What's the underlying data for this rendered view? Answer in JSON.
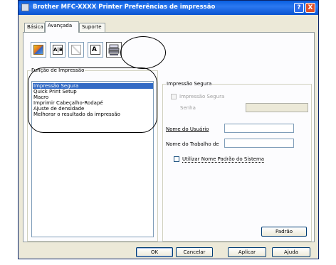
{
  "window": {
    "title": "Brother MFC-XXXX Printer Preferências de impressão"
  },
  "titlebar": {
    "help_symbol": "?",
    "close_symbol": "X"
  },
  "tabs": [
    {
      "label": "Básica",
      "active": false
    },
    {
      "label": "Avançada",
      "active": true
    },
    {
      "label": "Suporte",
      "active": false
    }
  ],
  "toolbar_icons": [
    {
      "name": "color-quality-icon"
    },
    {
      "name": "scaling-icon",
      "glyph": "A|B"
    },
    {
      "name": "watermark-icon"
    },
    {
      "name": "page-setup-icon",
      "glyph": "A"
    },
    {
      "name": "device-options-icon"
    }
  ],
  "function_group": {
    "title": "Função de Impressão",
    "items": [
      {
        "label": "Impressão Segura",
        "selected": true
      },
      {
        "label": "Quick Print Setup",
        "selected": false
      },
      {
        "label": "Macro",
        "selected": false
      },
      {
        "label": "Imprimir Cabeçalho-Rodapé",
        "selected": false
      },
      {
        "label": "Ajuste de densidade",
        "selected": false
      },
      {
        "label": "Melhorar o resultado da impressão",
        "selected": false
      }
    ]
  },
  "secure_group": {
    "title": "Impressão Segura",
    "secure_checkbox_label": "Impressão Segura",
    "password_label": "Senha",
    "username_label": "Nome do Usuário",
    "username_value": "",
    "jobname_label": "Nome do Trabalho de",
    "jobname_value": "",
    "default_name_label": "Utilizar Nome Padrão do Sistema"
  },
  "buttons": {
    "default": "Padrão",
    "ok": "OK",
    "cancel": "Cancelar",
    "apply": "Aplicar",
    "help": "Ajuda"
  }
}
